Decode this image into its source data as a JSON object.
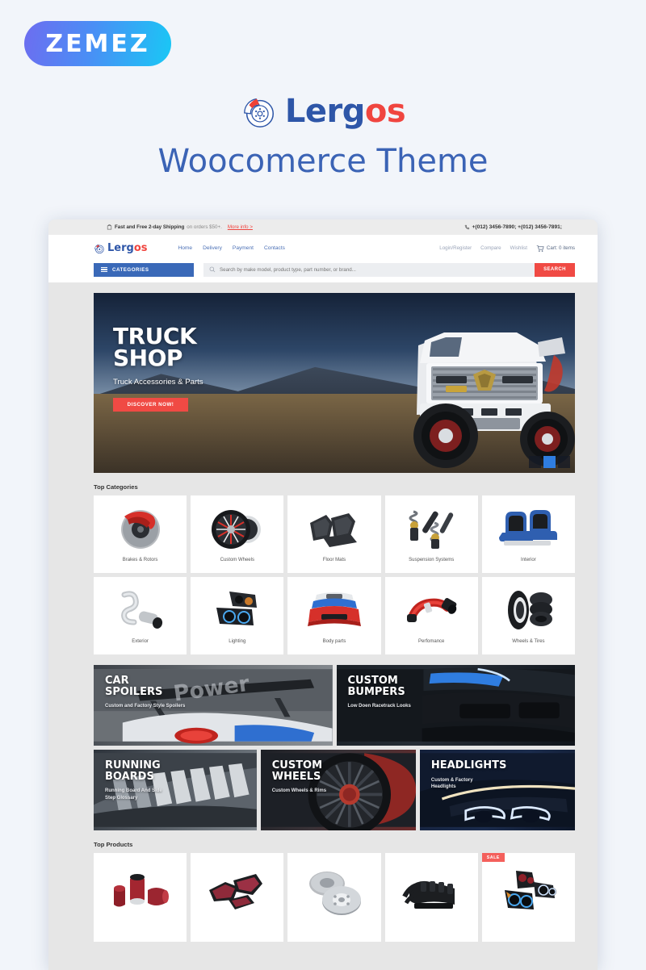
{
  "vendor": {
    "name": "ZEMEZ"
  },
  "promo": {
    "brand_part1": "Lerg",
    "brand_part2": "os",
    "subtitle": "Woocomerce Theme",
    "brand_icon": "brake-disc-icon"
  },
  "colors": {
    "brand_blue": "#2e56a8",
    "brand_red": "#f0453f",
    "accent_button": "#f04a44",
    "categories_blue": "#3a69b8",
    "page_bg": "#f2f5fa",
    "site_bg": "#e6e6e6"
  },
  "site": {
    "topbar": {
      "shipping_icon": "shipping-box-icon",
      "shipping_strong": "Fast and Free 2-day Shipping",
      "shipping_rest": "on orders $50+.",
      "more_info": "More info >",
      "phone_icon": "phone-icon",
      "phones": "+(012) 3456-7890; +(012) 3456-7891;"
    },
    "header": {
      "logo_part1": "Lerg",
      "logo_part2": "os",
      "nav": [
        {
          "label": "Home"
        },
        {
          "label": "Delivery"
        },
        {
          "label": "Payment"
        },
        {
          "label": "Contacts"
        }
      ],
      "account": [
        {
          "label": "Login/Register"
        },
        {
          "label": "Compare"
        },
        {
          "label": "Wishlist"
        }
      ],
      "cart_icon": "shopping-cart-icon",
      "cart_label": "Cart: 0 items"
    },
    "search": {
      "categories_label": "CATEGORIES",
      "menu_icon": "hamburger-menu-icon",
      "search_icon": "magnifier-icon",
      "placeholder": "Search by make model, product type, part number, or brand...",
      "value": "",
      "button_label": "SEARCH"
    },
    "hero": {
      "title_line1": "TRUCK",
      "title_line2": "SHOP",
      "subtitle": "Truck Accessories & Parts",
      "cta_label": "DISCOVER NOW!",
      "slides": 3,
      "active_slide": 2
    },
    "sections": {
      "top_categories_title": "Top Categories",
      "top_products_title": "Top Products"
    },
    "categories": [
      {
        "label": "Brakes & Rotors",
        "icon": "brake-rotor-thumb"
      },
      {
        "label": "Custom Wheels",
        "icon": "custom-wheel-thumb"
      },
      {
        "label": "Floor Mats",
        "icon": "floor-mat-thumb"
      },
      {
        "label": "Suspension Systems",
        "icon": "suspension-thumb"
      },
      {
        "label": "Interior",
        "icon": "car-seat-thumb"
      },
      {
        "label": "Exterior",
        "icon": "exhaust-thumb"
      },
      {
        "label": "Lighting",
        "icon": "headlight-thumb"
      },
      {
        "label": "Body parts",
        "icon": "bumper-thumb"
      },
      {
        "label": "Perfomance",
        "icon": "intake-thumb"
      },
      {
        "label": "Wheels & Tires",
        "icon": "tire-stack-thumb"
      }
    ],
    "promo_banners": [
      {
        "title_line1": "CAR",
        "title_line2": "SPOILERS",
        "subtitle_line1": "Custom and Factory Style Spoilers",
        "subtitle_line2": ""
      },
      {
        "title_line1": "CUSTOM",
        "title_line2": "BUMPERS",
        "subtitle_line1": "Low Doen Racetrack Looks",
        "subtitle_line2": ""
      },
      {
        "title_line1": "RUNNING",
        "title_line2": "BOARDS",
        "subtitle_line1": "Running Board And Side",
        "subtitle_line2": "Step Glossary"
      },
      {
        "title_line1": "CUSTOM",
        "title_line2": "WHEELS",
        "subtitle_line1": "Custom Wheels & Rims",
        "subtitle_line2": ""
      },
      {
        "title_line1": "HEADLIGHTS",
        "title_line2": "",
        "subtitle_line1": "Custom & Factory",
        "subtitle_line2": "Headlights"
      }
    ],
    "products": [
      {
        "icon": "air-filter-cone-thumb",
        "badge": ""
      },
      {
        "icon": "air-filter-panel-thumb",
        "badge": ""
      },
      {
        "icon": "brake-disc-pair-thumb",
        "badge": ""
      },
      {
        "icon": "intake-manifold-thumb",
        "badge": ""
      },
      {
        "icon": "headlight-pair-thumb",
        "badge": "SALE"
      }
    ]
  }
}
